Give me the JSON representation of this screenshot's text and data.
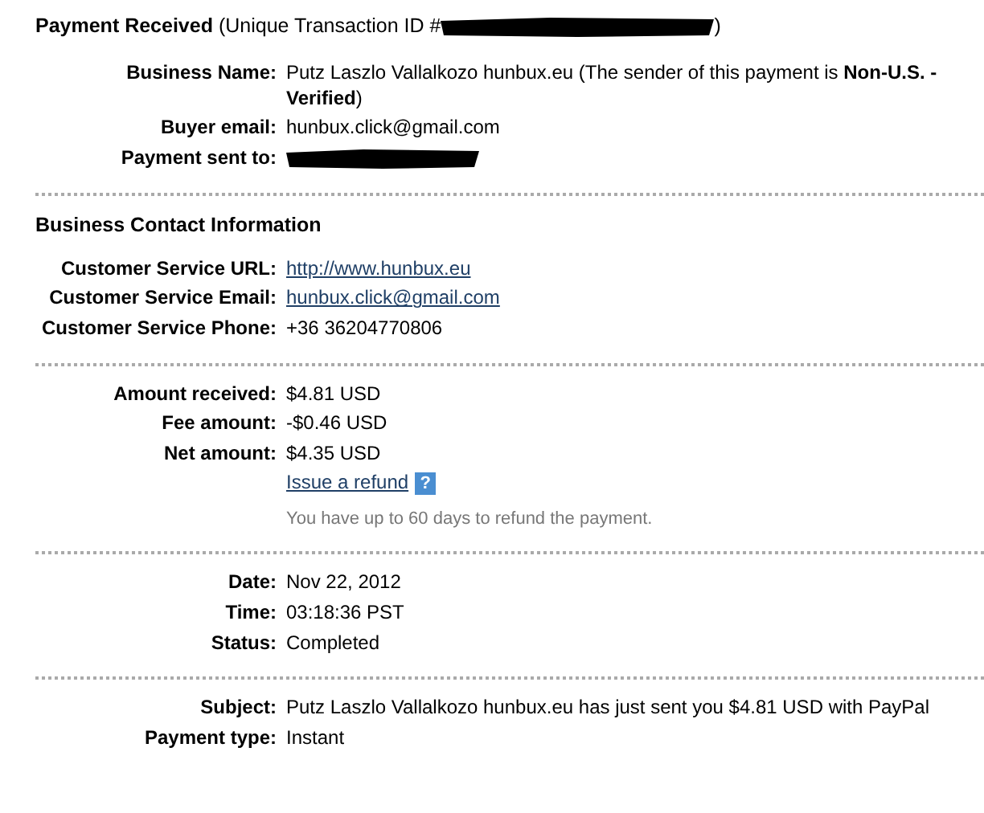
{
  "header": {
    "title": "Payment Received",
    "subtitle": "(Unique Transaction ID #",
    "subtitle_end": ")",
    "redacted": true
  },
  "sections": [
    {
      "rows": [
        {
          "kind": "rich",
          "label": "Business Name:",
          "value": "Putz Laszlo Vallalkozo hunbux.eu (The sender of this payment is **Non-U.S. - Verified**)"
        },
        {
          "kind": "text",
          "label": "Buyer email:",
          "value": "hunbux.click@gmail.com"
        },
        {
          "kind": "redacted",
          "label": "Payment sent to:"
        }
      ]
    },
    {
      "heading": "Business Contact Information",
      "rows": [
        {
          "kind": "link",
          "label": "Customer Service URL:",
          "value": "http://www.hunbux.eu"
        },
        {
          "kind": "link",
          "label": "Customer Service Email:",
          "value": "hunbux.click@gmail.com"
        },
        {
          "kind": "text",
          "label": "Customer Service Phone:",
          "value": "+36 36204770806"
        }
      ]
    },
    {
      "rows": [
        {
          "kind": "text",
          "label": "Amount received:",
          "value": "$4.81 USD"
        },
        {
          "kind": "text",
          "label": "Fee amount:",
          "value": "-$0.46 USD"
        },
        {
          "kind": "text",
          "label": "Net amount:",
          "value": "$4.35 USD"
        },
        {
          "kind": "refund",
          "value": "Issue a refund",
          "help": "?"
        },
        {
          "kind": "note",
          "value": "You have up to 60 days to refund the payment."
        }
      ]
    },
    {
      "rows": [
        {
          "kind": "text",
          "label": "Date:",
          "value": "Nov 22, 2012"
        },
        {
          "kind": "text",
          "label": "Time:",
          "value": "03:18:36 PST"
        },
        {
          "kind": "text",
          "label": "Status:",
          "value": "Completed"
        }
      ]
    },
    {
      "rows": [
        {
          "kind": "text",
          "label": "Subject:",
          "value": "Putz Laszlo Vallalkozo hunbux.eu has just sent you $4.81 USD with PayPal"
        },
        {
          "kind": "text",
          "label": "Payment type:",
          "value": "Instant"
        }
      ]
    }
  ]
}
